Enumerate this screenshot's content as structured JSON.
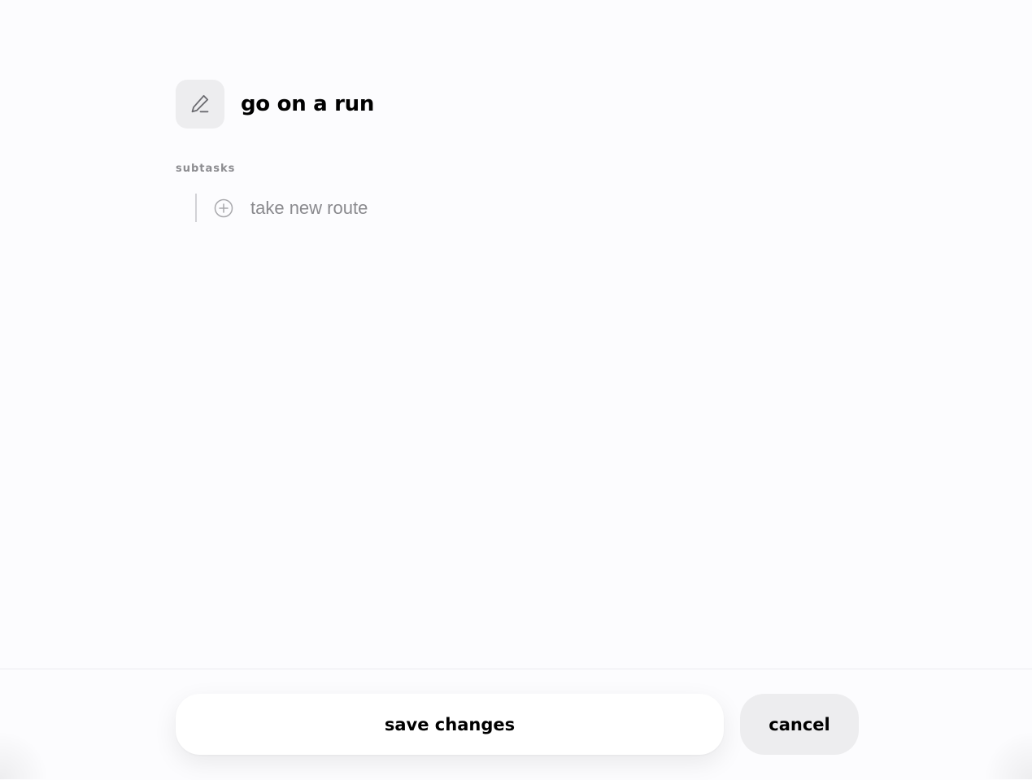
{
  "task": {
    "title": "go on a run",
    "edit_icon": "pencil-icon"
  },
  "subtasks": {
    "label": "subtasks",
    "add_icon": "plus-circle-icon",
    "input_value": "take new route"
  },
  "footer": {
    "save_label": "save changes",
    "cancel_label": "cancel"
  },
  "colors": {
    "background": "#fcfcfe",
    "icon_button_bg": "#ededef",
    "muted_text": "#8c8c90",
    "cancel_bg": "#ededef",
    "save_bg": "#ffffff"
  }
}
